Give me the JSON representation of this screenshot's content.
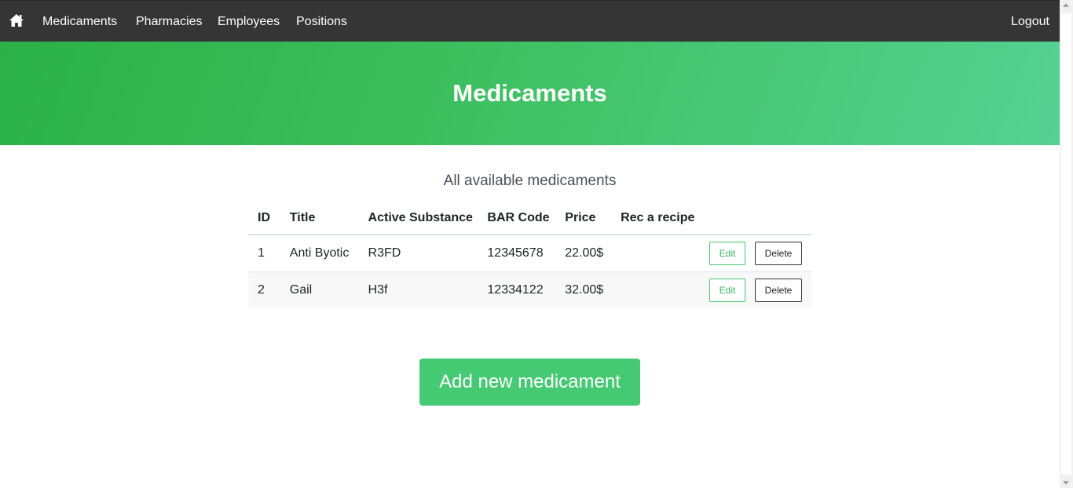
{
  "navbar": {
    "home_icon": "home-icon",
    "links": [
      "Medicaments",
      "Pharmacies",
      "Employees",
      "Positions"
    ],
    "logout_label": "Logout",
    "background": "#353535"
  },
  "hero": {
    "title": "Medicaments",
    "gradient_start": "#2bb148",
    "gradient_end": "#55d193"
  },
  "main": {
    "subtitle": "All available medicaments",
    "table": {
      "columns": [
        "ID",
        "Title",
        "Active Substance",
        "BAR Code",
        "Price",
        "Rec a recipe",
        ""
      ],
      "rows": [
        {
          "id": "1",
          "title": "Anti Byotic",
          "substance": "R3FD",
          "barcode": "12345678",
          "price": "22.00$",
          "recipe": ""
        },
        {
          "id": "2",
          "title": "Gail",
          "substance": "H3f",
          "barcode": "12334122",
          "price": "32.00$",
          "recipe": ""
        }
      ],
      "edit_label": "Edit",
      "delete_label": "Delete"
    },
    "add_button_label": "Add new medicament",
    "accent": "#46c973"
  }
}
